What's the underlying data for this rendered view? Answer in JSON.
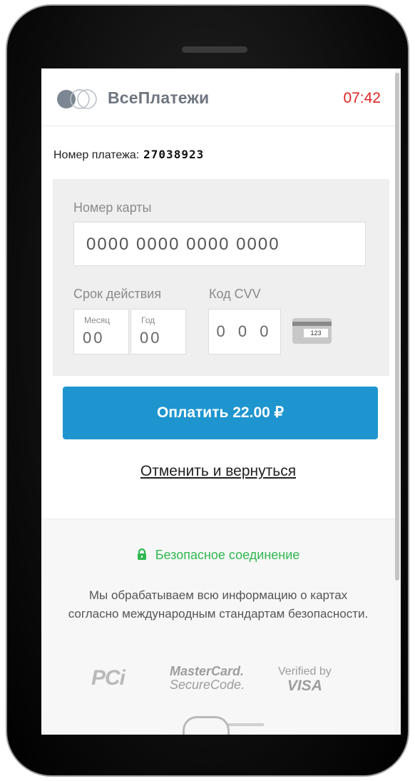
{
  "header": {
    "brand": "ВсеПлатежи",
    "timer": "07:42"
  },
  "payment": {
    "number_label": "Номер платежа:",
    "number_value": "27038923"
  },
  "card_form": {
    "card_number_label": "Номер карты",
    "card_number_placeholder": "0000 0000 0000 0000",
    "expiry_label": "Срок действия",
    "month_caption": "Месяц",
    "month_placeholder": "00",
    "year_caption": "Год",
    "year_placeholder": "00",
    "cvv_label": "Код CVV",
    "cvv_placeholder": "0 0 0",
    "cvv_icon_code": "123"
  },
  "actions": {
    "pay_button": "Оплатить 22.00 ₽",
    "cancel_link": "Отменить и вернуться"
  },
  "footer": {
    "secure_text": "Безопасное соединение",
    "secure_note_line1": "Мы обрабатываем всю информацию о картах",
    "secure_note_line2": "согласно международным стандартам безопасности.",
    "logo_pci": "PCi",
    "logo_mastercard_line1": "MasterCard.",
    "logo_mastercard_line2": "SecureCode.",
    "logo_visa_line1": "Verified by",
    "logo_visa_line2": "VISA"
  },
  "colors": {
    "accent": "#1e95cf",
    "timer": "#e02424",
    "secure": "#2fb84f"
  },
  "icons": [
    "brand-logo-icon",
    "lock-icon",
    "cvv-card-icon"
  ]
}
